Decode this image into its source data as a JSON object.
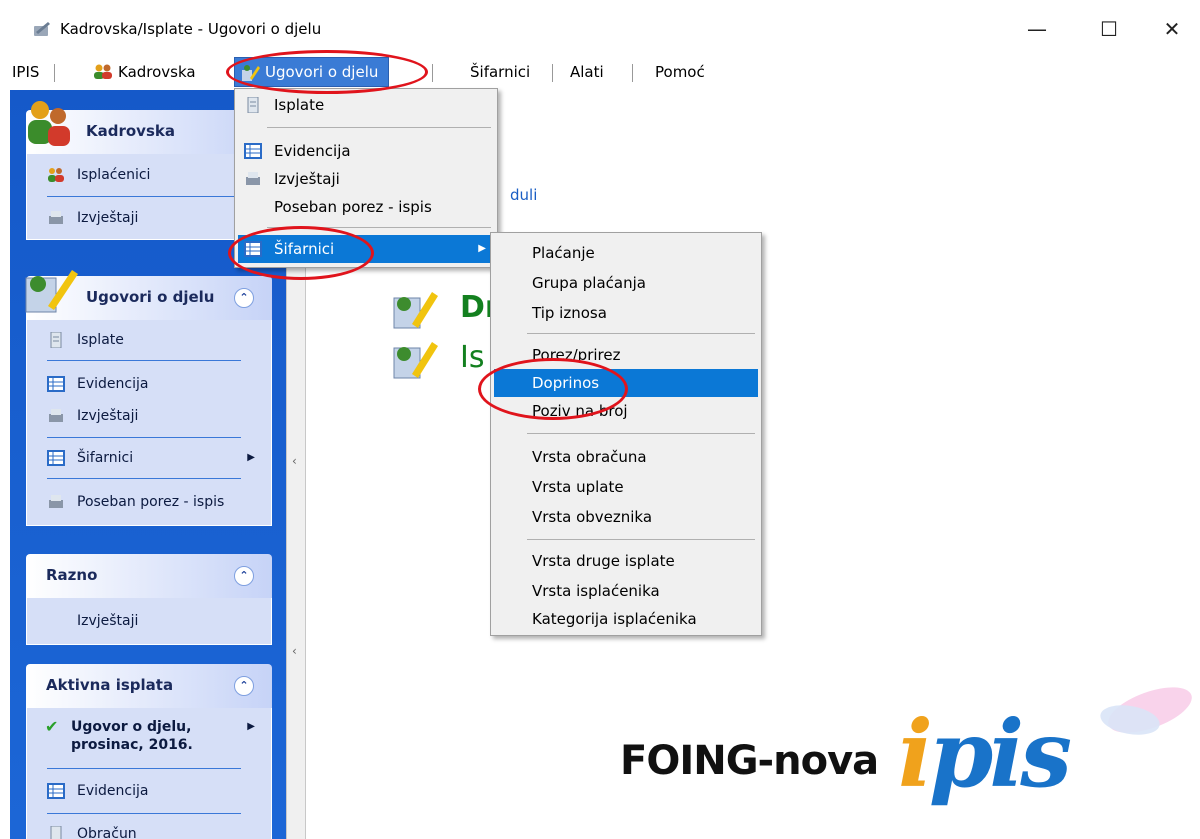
{
  "window": {
    "title": "Kadrovska/Isplate - Ugovori o djelu",
    "minimize_glyph": "—",
    "maximize_glyph": "☐",
    "close_glyph": "✕"
  },
  "menubar": {
    "items": [
      {
        "label": "IPIS"
      },
      {
        "label": "Kadrovska",
        "icon": "users-icon"
      },
      {
        "label": "Ugovori o djelu",
        "icon": "contract-icon",
        "active": true
      },
      {
        "label": "Šifarnici"
      },
      {
        "label": "Alati"
      },
      {
        "label": "Pomoć"
      }
    ]
  },
  "dropdown": {
    "items": [
      {
        "label": "Isplate",
        "icon": "document-icon"
      },
      {
        "label": "Evidencija",
        "icon": "grid-icon"
      },
      {
        "label": "Izvještaji",
        "icon": "printer-icon"
      },
      {
        "label": "Poseban porez - ispis"
      },
      {
        "label": "Šifarnici",
        "icon": "grid-icon",
        "highlighted": true
      }
    ]
  },
  "submenu": {
    "items": [
      "Plaćanje",
      "Grupa plaćanja",
      "Tip iznosa",
      "Porez/prirez",
      "Doprinos",
      "Poziv na broj",
      "Vrsta obračuna",
      "Vrsta uplate",
      "Vrsta obveznika",
      "Vrsta druge isplate",
      "Vrsta isplaćenika",
      "Kategorija isplaćenika"
    ],
    "highlighted": "Doprinos"
  },
  "sidebar": {
    "kadrovska": {
      "title": "Kadrovska",
      "items": [
        "Isplaćenici",
        "Izvještaji"
      ]
    },
    "ugovori": {
      "title": "Ugovori o djelu",
      "chevron": "⌃",
      "items": [
        "Isplate",
        "Evidencija",
        "Izvještaji",
        "Šifarnici",
        "Poseban porez - ispis"
      ]
    },
    "razno": {
      "title": "Razno",
      "chevron": "⌃",
      "items": [
        "Izvještaji"
      ]
    },
    "aktivna": {
      "title": "Aktivna isplata",
      "chevron": "⌃",
      "active_line1": "Ugovor o djelu,",
      "active_line2": "prosinac, 2016.",
      "items": [
        "Evidencija",
        "Obračun"
      ]
    }
  },
  "content": {
    "moduli_fragment": "duli",
    "heading_fragment_1": "Dr",
    "heading_fragment_2": "Is",
    "logo_text": "FOING-nova",
    "logo_i": "i",
    "logo_pis": "pis"
  },
  "colors": {
    "sidebar_blue": "#1559c9",
    "menu_highlight": "#0b78d6",
    "annotation_red": "#e0141c",
    "logo_orange": "#f0a21c",
    "logo_blue": "#1973c9",
    "heading_green": "#13801f"
  }
}
